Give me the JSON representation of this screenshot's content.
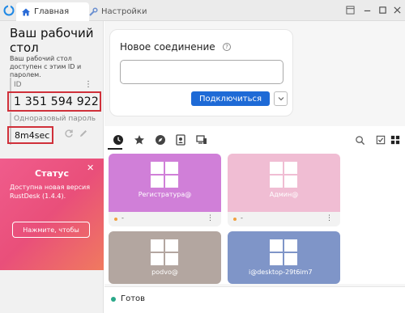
{
  "titlebar": {
    "tabs": [
      {
        "label": "Главная",
        "icon": "home-icon",
        "active": true
      },
      {
        "label": "Настройки",
        "icon": "wrench-icon",
        "active": false
      }
    ]
  },
  "sidebar": {
    "title": "Ваш рабочий стол",
    "description": "Ваш рабочий стол доступен с этим ID и паролем.",
    "id_label": "ID",
    "id_value": "1 351 594 922",
    "password_label": "Одноразовый пароль",
    "password_value": "8m4sec"
  },
  "status_card": {
    "title": "Статус",
    "text": "Доступна новая версия RustDesk (1.4.4).",
    "button": "Нажмите, чтобы",
    "close": "✕"
  },
  "connection": {
    "title": "Новое соединение",
    "help": "?",
    "input_value": "",
    "connect_button": "Подключиться"
  },
  "peers": [
    {
      "name": "Регистратура@",
      "sub": "-",
      "color": "#d07fd8"
    },
    {
      "name": "Админ@",
      "sub": "-",
      "color": "#f0bdd3"
    },
    {
      "name": "podvo@",
      "sub": "",
      "color": "#b3a6a0"
    },
    {
      "name": "i@desktop-29t6im7",
      "sub": "",
      "color": "#7f95c8"
    }
  ],
  "statusbar": {
    "text": "Готов",
    "dot_color": "#2aa889"
  },
  "colors": {
    "accent": "#1e6ad6",
    "highlight_border": "#d0303a"
  }
}
